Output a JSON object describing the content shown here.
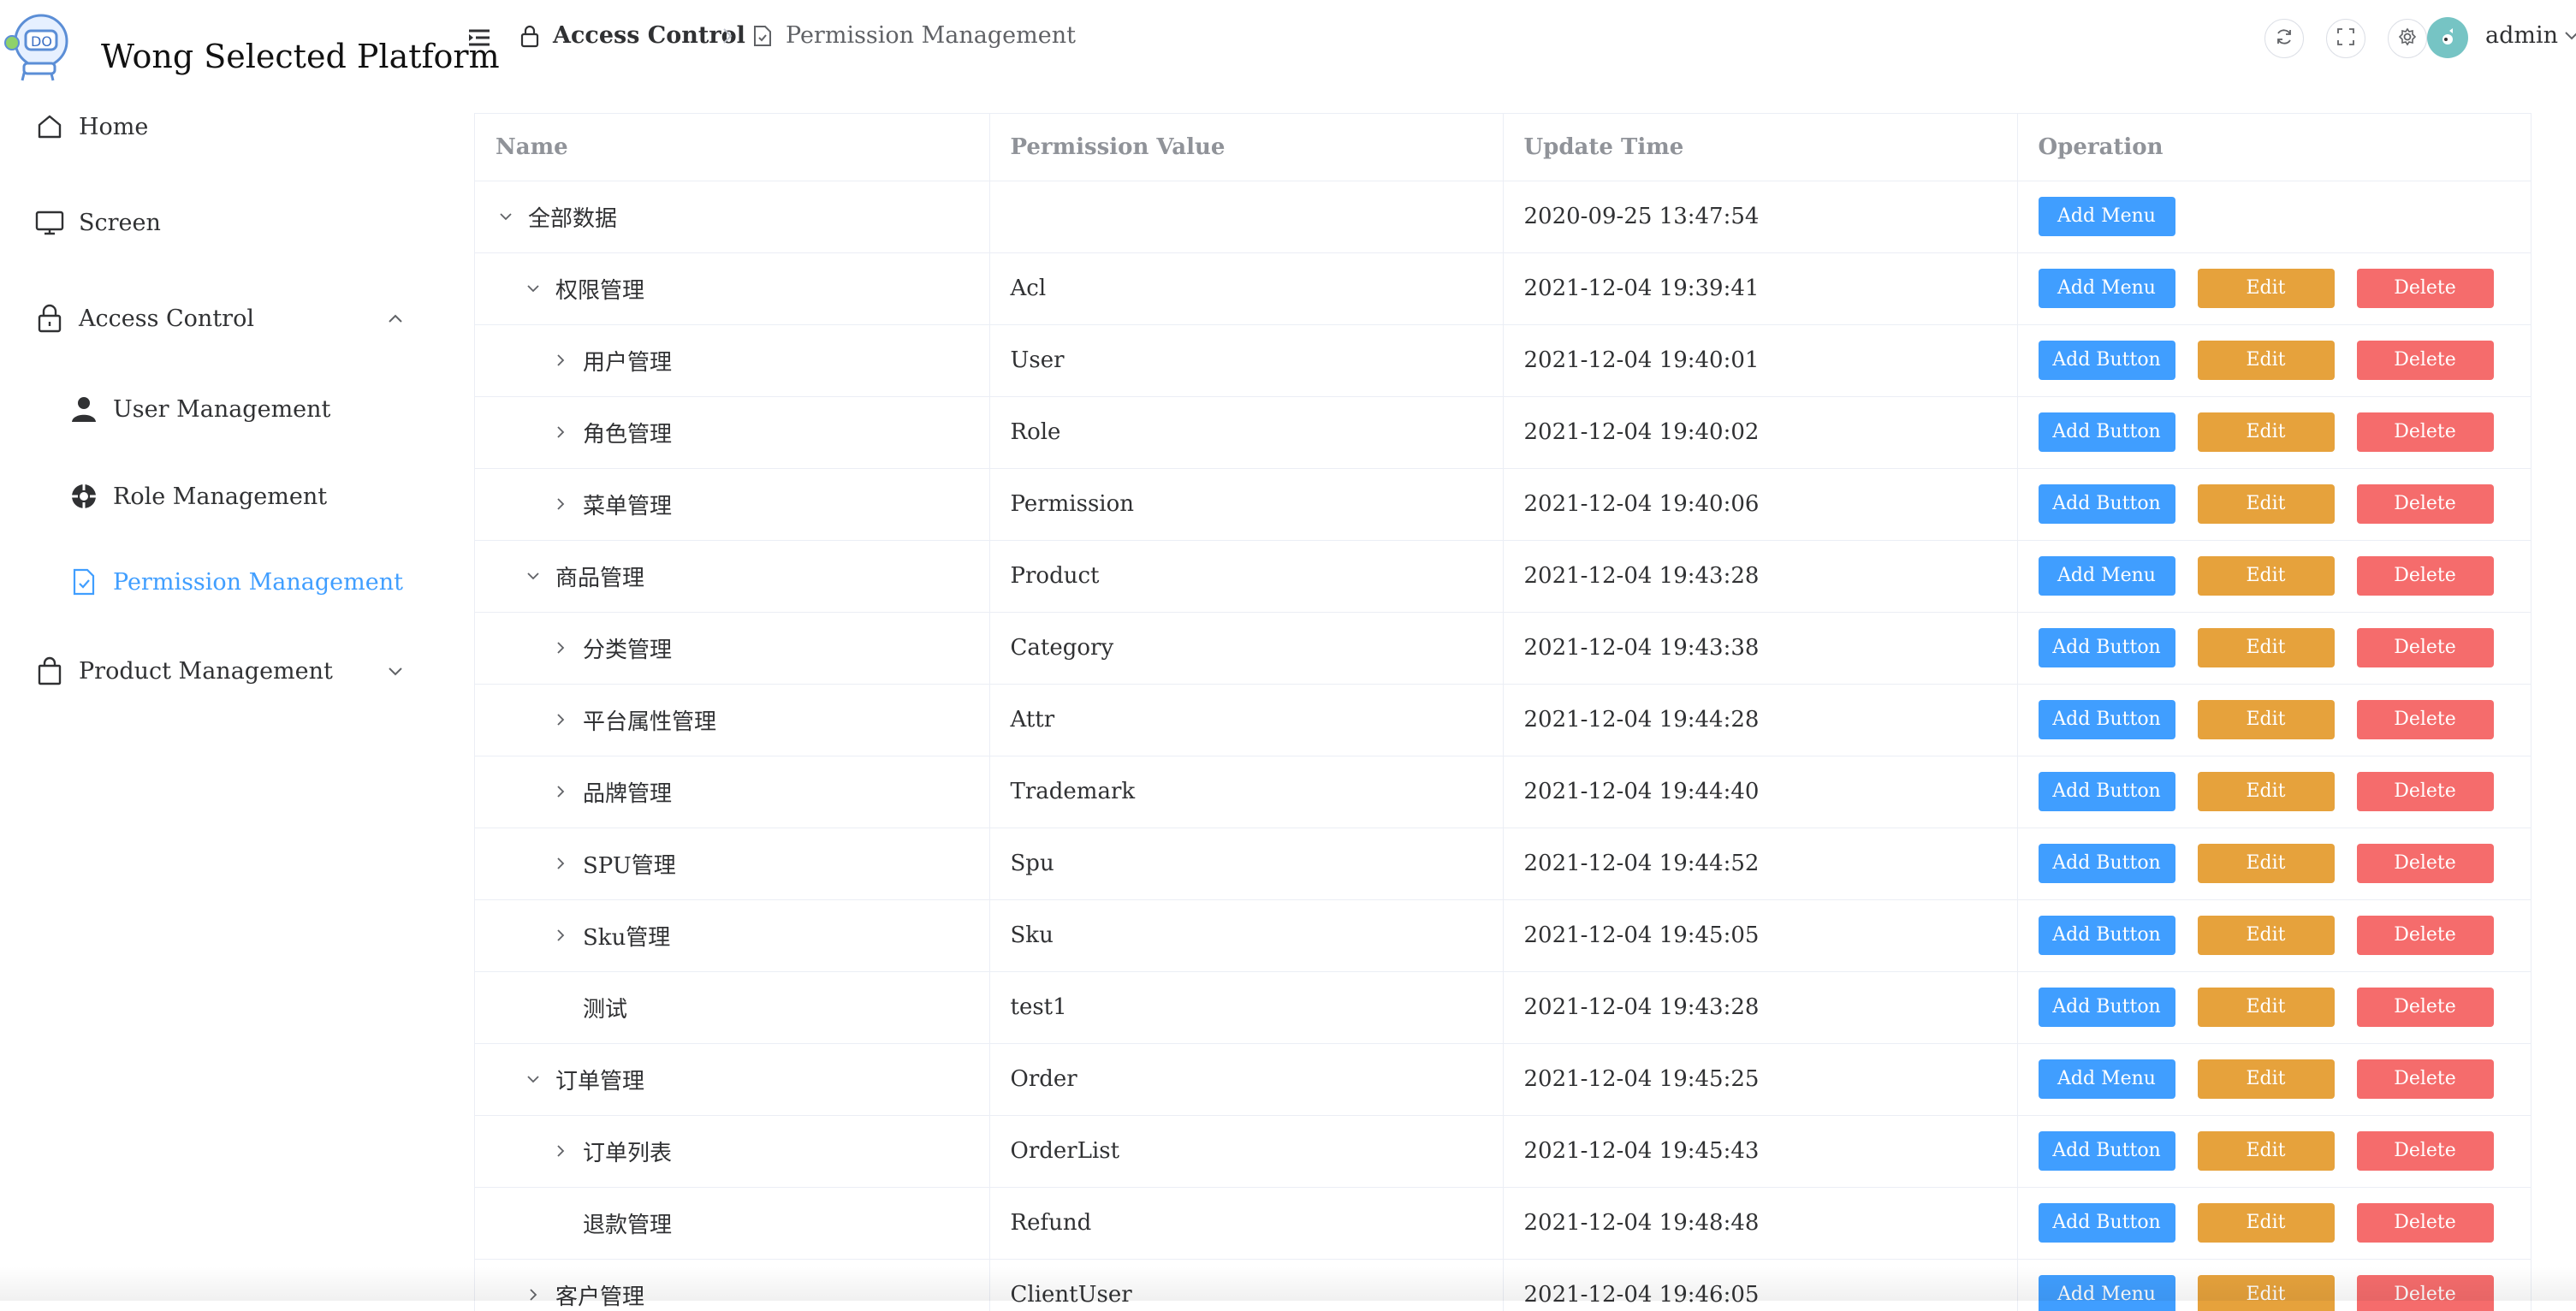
{
  "app": {
    "title": "Wong Selected Platform"
  },
  "sidebar": {
    "items": [
      {
        "label": "Home",
        "icon": "home-icon"
      },
      {
        "label": "Screen",
        "icon": "monitor-icon"
      },
      {
        "label": "Access Control",
        "icon": "lock-icon",
        "expanded": true
      },
      {
        "label": "Product Management",
        "icon": "shopping-bag-icon",
        "expanded": false
      }
    ],
    "sub_items": [
      {
        "label": "User Management",
        "icon": "user-icon"
      },
      {
        "label": "Role Management",
        "icon": "role-icon"
      },
      {
        "label": "Permission Management",
        "icon": "document-check-icon",
        "active": true
      }
    ]
  },
  "header": {
    "breadcrumb": [
      {
        "label": "Access Control",
        "icon": "lock-icon"
      },
      {
        "label": "Permission Management",
        "icon": "document-icon"
      }
    ],
    "user": {
      "name": "admin"
    }
  },
  "table": {
    "columns": [
      "Name",
      "Permission Value",
      "Update Time",
      "Operation"
    ],
    "rows": [
      {
        "name": "全部数据",
        "level": 0,
        "expander": "down",
        "value": "",
        "time": "2020-09-25 13:47:54",
        "add_label": "Add Menu",
        "edit": false,
        "delete": false
      },
      {
        "name": "权限管理",
        "level": 1,
        "expander": "down",
        "value": "Acl",
        "time": "2021-12-04 19:39:41",
        "add_label": "Add Menu",
        "edit": true,
        "delete": true
      },
      {
        "name": "用户管理",
        "level": 2,
        "expander": "right",
        "value": "User",
        "time": "2021-12-04 19:40:01",
        "add_label": "Add Button",
        "edit": true,
        "delete": true
      },
      {
        "name": "角色管理",
        "level": 2,
        "expander": "right",
        "value": "Role",
        "time": "2021-12-04 19:40:02",
        "add_label": "Add Button",
        "edit": true,
        "delete": true
      },
      {
        "name": "菜单管理",
        "level": 2,
        "expander": "right",
        "value": "Permission",
        "time": "2021-12-04 19:40:06",
        "add_label": "Add Button",
        "edit": true,
        "delete": true
      },
      {
        "name": "商品管理",
        "level": 1,
        "expander": "down",
        "value": "Product",
        "time": "2021-12-04 19:43:28",
        "add_label": "Add Menu",
        "edit": true,
        "delete": true
      },
      {
        "name": "分类管理",
        "level": 2,
        "expander": "right",
        "value": "Category",
        "time": "2021-12-04 19:43:38",
        "add_label": "Add Button",
        "edit": true,
        "delete": true
      },
      {
        "name": "平台属性管理",
        "level": 2,
        "expander": "right",
        "value": "Attr",
        "time": "2021-12-04 19:44:28",
        "add_label": "Add Button",
        "edit": true,
        "delete": true
      },
      {
        "name": "品牌管理",
        "level": 2,
        "expander": "right",
        "value": "Trademark",
        "time": "2021-12-04 19:44:40",
        "add_label": "Add Button",
        "edit": true,
        "delete": true
      },
      {
        "name": "SPU管理",
        "level": 2,
        "expander": "right",
        "value": "Spu",
        "time": "2021-12-04 19:44:52",
        "add_label": "Add Button",
        "edit": true,
        "delete": true
      },
      {
        "name": "Sku管理",
        "level": 2,
        "expander": "right",
        "value": "Sku",
        "time": "2021-12-04 19:45:05",
        "add_label": "Add Button",
        "edit": true,
        "delete": true
      },
      {
        "name": "测试",
        "level": 2,
        "expander": "none",
        "value": "test1",
        "time": "2021-12-04 19:43:28",
        "add_label": "Add Button",
        "edit": true,
        "delete": true
      },
      {
        "name": "订单管理",
        "level": 1,
        "expander": "down",
        "value": "Order",
        "time": "2021-12-04 19:45:25",
        "add_label": "Add Menu",
        "edit": true,
        "delete": true
      },
      {
        "name": "订单列表",
        "level": 2,
        "expander": "right",
        "value": "OrderList",
        "time": "2021-12-04 19:45:43",
        "add_label": "Add Button",
        "edit": true,
        "delete": true
      },
      {
        "name": "退款管理",
        "level": 2,
        "expander": "none",
        "value": "Refund",
        "time": "2021-12-04 19:48:48",
        "add_label": "Add Button",
        "edit": true,
        "delete": true
      },
      {
        "name": "客户管理",
        "level": 1,
        "expander": "right",
        "value": "ClientUser",
        "time": "2021-12-04 19:46:05",
        "add_label": "Add Menu",
        "edit": true,
        "delete": true
      }
    ],
    "edit_label": "Edit",
    "delete_label": "Delete"
  },
  "colors": {
    "primary": "#409eff",
    "warning": "#e6a23c",
    "danger": "#f56c6c",
    "border": "#ebeef5"
  }
}
